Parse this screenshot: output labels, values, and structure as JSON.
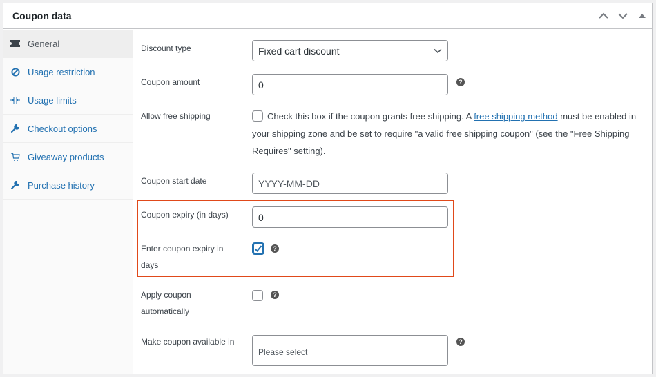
{
  "panel": {
    "title": "Coupon data",
    "actions": [
      {
        "name": "move-up",
        "icon": "chevron-up-icon"
      },
      {
        "name": "move-down",
        "icon": "chevron-down-icon"
      },
      {
        "name": "toggle-panel",
        "icon": "triangle-up-icon"
      }
    ]
  },
  "tabs": [
    {
      "label": "General",
      "icon": "ticket-icon",
      "active": true
    },
    {
      "label": "Usage restriction",
      "icon": "ban-icon",
      "active": false
    },
    {
      "label": "Usage limits",
      "icon": "limits-icon",
      "active": false
    },
    {
      "label": "Checkout options",
      "icon": "wrench-icon",
      "active": false
    },
    {
      "label": "Giveaway products",
      "icon": "cart-icon",
      "active": false
    },
    {
      "label": "Purchase history",
      "icon": "wrench-icon",
      "active": false
    }
  ],
  "fields": {
    "discount_type": {
      "label": "Discount type",
      "value": "Fixed cart discount"
    },
    "coupon_amount": {
      "label": "Coupon amount",
      "value": "0"
    },
    "free_shipping": {
      "label": "Allow free shipping",
      "checked": false,
      "desc_before": "Check this box if the coupon grants free shipping. A ",
      "link": "free shipping method",
      "desc_after": " must be enabled in your shipping zone and be set to require \"a valid free shipping coupon\" (see the \"Free Shipping Requires\" setting)."
    },
    "start_date": {
      "label": "Coupon start date",
      "placeholder": "YYYY-MM-DD"
    },
    "expiry_days": {
      "label": "Coupon expiry (in days)",
      "value": "0"
    },
    "enter_expiry_days": {
      "label": "Enter coupon expiry in days",
      "checked": true
    },
    "apply_auto": {
      "label": "Apply coupon automatically",
      "checked": false
    },
    "available_in": {
      "label": "Make coupon available in",
      "placeholder": "Please select"
    }
  },
  "help_glyph": "?",
  "colors": {
    "accent": "#2271b1",
    "highlight": "#e0491a"
  }
}
